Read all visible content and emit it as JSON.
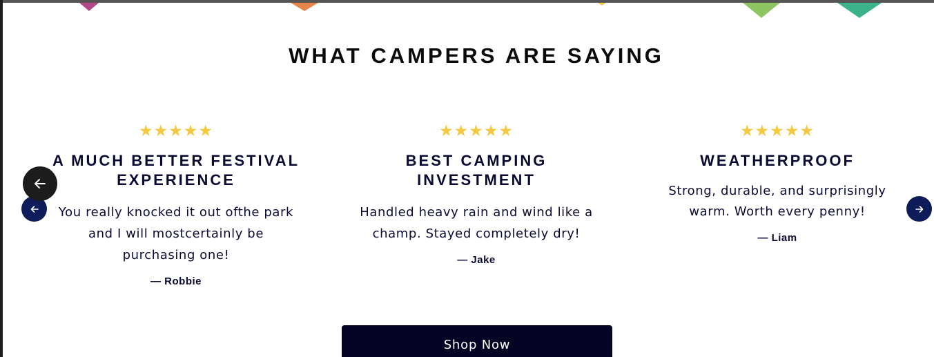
{
  "section": {
    "heading": "WHAT CAMPERS ARE SAYING"
  },
  "pennant_colors": [
    "#b24a8a",
    "#e8844a",
    "#f5c842",
    "#8fc462",
    "#3bb28a"
  ],
  "accent_colors": {
    "stars": "#f5c842",
    "text": "#0b0a33",
    "arrow": "#0e1d5a",
    "button": "#050424"
  },
  "testimonials": [
    {
      "stars": "★★★★★",
      "rating": 5,
      "title": "A MUCH BETTER FESTIVAL EXPERIENCE",
      "body": "You really knocked it out ofthe park and I will mostcertainly be purchasing one!",
      "author": "— Robbie"
    },
    {
      "stars": "★★★★★",
      "rating": 5,
      "title": "BEST CAMPING INVESTMENT",
      "body": "Handled heavy rain and wind like a champ. Stayed completely dry!",
      "author": "— Jake"
    },
    {
      "stars": "★★★★★",
      "rating": 5,
      "title": "WEATHERPROOF",
      "body": "Strong, durable, and surprisingly warm. Worth every penny!",
      "author": "— Liam"
    }
  ],
  "carousel": {
    "back_icon": "arrow-left-icon",
    "prev_icon": "arrow-left-icon",
    "next_icon": "arrow-right-icon"
  },
  "cta": {
    "label": "Shop Now"
  }
}
